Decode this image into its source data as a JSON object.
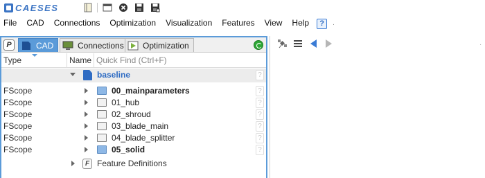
{
  "app": {
    "logo_text": "CAESES"
  },
  "menu": [
    "File",
    "CAD",
    "Connections",
    "Optimization",
    "Visualization",
    "Features",
    "View",
    "Help"
  ],
  "help_button": "?",
  "left_panel": {
    "p_button": "P",
    "tabs": [
      {
        "label": "CAD",
        "active": true
      },
      {
        "label": "Connections",
        "active": false
      },
      {
        "label": "Optimization",
        "active": false
      }
    ],
    "columns": {
      "type": "Type",
      "name": "Name",
      "quickfind": "Quick Find (Ctrl+F)"
    },
    "root": {
      "label": "baseline",
      "q": "?"
    },
    "rows": [
      {
        "type": "FScope",
        "label": "00_mainparameters",
        "folder": "blue",
        "bold": true,
        "q": "?"
      },
      {
        "type": "FScope",
        "label": "01_hub",
        "folder": "plain",
        "bold": false,
        "q": "?"
      },
      {
        "type": "FScope",
        "label": "02_shroud",
        "folder": "plain",
        "bold": false,
        "q": "?"
      },
      {
        "type": "FScope",
        "label": "03_blade_main",
        "folder": "plain",
        "bold": false,
        "q": "?"
      },
      {
        "type": "FScope",
        "label": "04_blade_splitter",
        "folder": "plain",
        "bold": false,
        "q": "?"
      },
      {
        "type": "FScope",
        "label": "05_solid",
        "folder": "blue",
        "bold": true,
        "q": "?"
      }
    ],
    "feature_definitions": {
      "icon_letter": "F",
      "label": "Feature Definitions"
    }
  },
  "colors": {
    "accent": "#5b9bd9",
    "brand": "#3b74c4",
    "link": "#2f6cc3",
    "refresh": "#2ea836"
  }
}
